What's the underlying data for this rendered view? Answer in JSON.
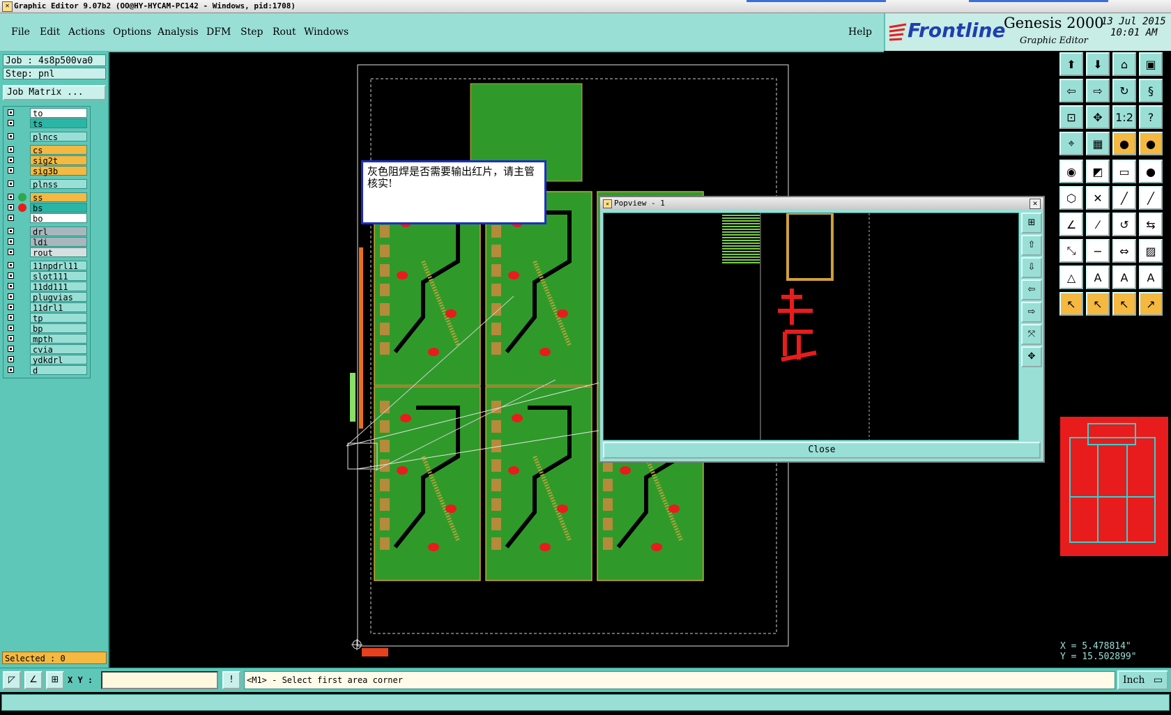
{
  "window": {
    "title": "Graphic Editor 9.07b2 (OO@HY-HYCAM-PC142 - Windows, pid:1708)"
  },
  "menu": {
    "file": "File",
    "edit": "Edit",
    "actions": "Actions",
    "options": "Options",
    "analysis": "Analysis",
    "dfm": "DFM",
    "step": "Step",
    "rout": "Rout",
    "windows": "Windows",
    "help": "Help"
  },
  "brand": {
    "logo": "Frontline",
    "product": "Genesis 2000",
    "subtitle": "Graphic Editor",
    "date": "13 Jul 2015",
    "time": "10:01 AM"
  },
  "job": {
    "job_label": "Job : 4s8p500va0",
    "step_label": "Step: pnl",
    "matrix_button": "Job Matrix ..."
  },
  "layers": [
    {
      "name": "to",
      "color": "#ffffff",
      "dot": ""
    },
    {
      "name": "ts",
      "color": "#2bb5a5",
      "dot": ""
    },
    {
      "name": "plncs",
      "color": "#9adfd6",
      "dot": ""
    },
    {
      "name": "cs",
      "color": "#f5b841",
      "dot": ""
    },
    {
      "name": "sig2t",
      "color": "#f5b841",
      "dot": ""
    },
    {
      "name": "sig3b",
      "color": "#f5b841",
      "dot": ""
    },
    {
      "name": "plnss",
      "color": "#9adfd6",
      "dot": ""
    },
    {
      "name": "ss",
      "color": "#f5b841",
      "dot": "#2ea84a"
    },
    {
      "name": "bs",
      "color": "#2bb5a5",
      "dot": "#e81c1c"
    },
    {
      "name": "bo",
      "color": "#ffffff",
      "dot": ""
    },
    {
      "name": "drl",
      "color": "#a9b7bd",
      "dot": ""
    },
    {
      "name": "ldi",
      "color": "#a9b7bd",
      "dot": ""
    },
    {
      "name": "rout",
      "color": "#d9dfe0",
      "dot": ""
    },
    {
      "name": "11npdrl11",
      "color": "#9adfd6",
      "dot": ""
    },
    {
      "name": "slot111",
      "color": "#9adfd6",
      "dot": ""
    },
    {
      "name": "11dd111",
      "color": "#9adfd6",
      "dot": ""
    },
    {
      "name": "plugvias",
      "color": "#9adfd6",
      "dot": ""
    },
    {
      "name": "11drl1",
      "color": "#9adfd6",
      "dot": ""
    },
    {
      "name": "tp",
      "color": "#9adfd6",
      "dot": ""
    },
    {
      "name": "bp",
      "color": "#9adfd6",
      "dot": ""
    },
    {
      "name": "mpth",
      "color": "#9adfd6",
      "dot": ""
    },
    {
      "name": "cvia",
      "color": "#9adfd6",
      "dot": ""
    },
    {
      "name": "ydkdrl",
      "color": "#9adfd6",
      "dot": ""
    },
    {
      "name": "d",
      "color": "#9adfd6",
      "dot": ""
    }
  ],
  "selected_label": "Selected : 0",
  "note": {
    "text": "灰色阻焊是否需要输出红片，请主管核实!"
  },
  "popview": {
    "title": "Popview - 1",
    "close_label": "Close"
  },
  "coords": {
    "x": "X = 5.478814\"",
    "y": "Y = 15.502899\""
  },
  "status": {
    "xy_label": "X Y :",
    "prompt": "<M1> - Select first area corner",
    "unit": "Inch"
  },
  "colors": {
    "panel": "#5ec7b8",
    "menu": "#9adfd6",
    "pcb_green": "#2f9a2a",
    "pad_red": "#e81c1c",
    "highlight": "#f5b841"
  }
}
